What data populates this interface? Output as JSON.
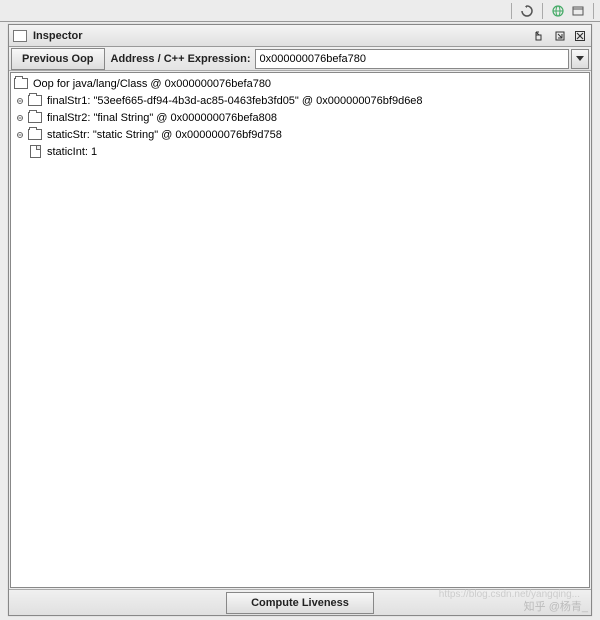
{
  "window": {
    "title": "Inspector"
  },
  "toolbar": {
    "previous_oop": "Previous Oop",
    "address_label": "Address / C++ Expression:",
    "address_value": "0x000000076befa780"
  },
  "tree": {
    "root": "Oop for java/lang/Class @ 0x000000076befa780",
    "children": [
      {
        "icon": "folder",
        "expandable": true,
        "label": "finalStr1: \"53eef665-df94-4b3d-ac85-0463feb3fd05\" @ 0x000000076bf9d6e8"
      },
      {
        "icon": "folder",
        "expandable": true,
        "label": "finalStr2: \"final String\" @ 0x000000076befa808"
      },
      {
        "icon": "folder",
        "expandable": true,
        "label": "staticStr: \"static String\" @ 0x000000076bf9d758"
      },
      {
        "icon": "doc",
        "expandable": false,
        "label": "staticInt: 1"
      }
    ]
  },
  "bottom": {
    "compute_liveness": "Compute Liveness"
  },
  "watermark": "知乎 @杨青_",
  "watermark2": "https://blog.csdn.net/yangqing..."
}
